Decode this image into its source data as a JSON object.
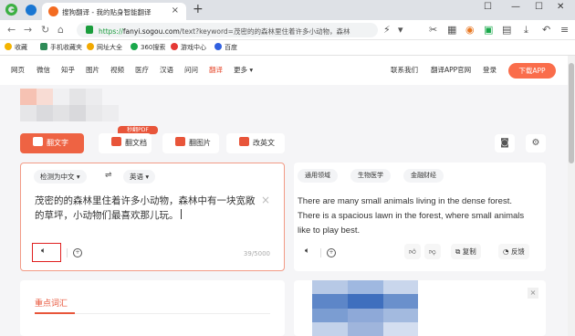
{
  "browser": {
    "tab_title": "搜狗翻译 - 我的贴身智能翻译",
    "tab_close": "×",
    "new_tab": "+",
    "window_controls": [
      "☐",
      "—",
      "☐",
      "✕"
    ],
    "url_scheme": "https://",
    "url_host": "fanyi.sogou.com",
    "url_rest": "/text?keyword=茂密的的森林里住着许多小动物，森林",
    "nav_icons": [
      "back-icon",
      "forward-icon",
      "refresh-icon",
      "home-icon"
    ]
  },
  "bookmarks": [
    {
      "label": "收藏",
      "color": "#f4b400"
    },
    {
      "label": "手机收藏夹",
      "color": "#2e8b57"
    },
    {
      "label": "网址大全",
      "color": "#f2a900"
    },
    {
      "label": "360搜索",
      "color": "#1aa84b"
    },
    {
      "label": "游戏中心",
      "color": "#e53935"
    },
    {
      "label": "百度",
      "color": "#3060e0"
    }
  ],
  "site_nav": {
    "items": [
      "网页",
      "微信",
      "知乎",
      "图片",
      "视频",
      "医疗",
      "汉语",
      "问问",
      "翻译",
      "更多"
    ],
    "active": "翻译",
    "right_links": [
      "联系我们",
      "翻译APP官网",
      "登录"
    ],
    "download_button": "下载APP"
  },
  "modes": {
    "pdf_badge": "秒翻PDF",
    "text": "翻文字",
    "doc": "翻文档",
    "img": "翻图片",
    "en": "改英文"
  },
  "source": {
    "detect_lang": "检测为中文",
    "swap": "⇌",
    "target_lang": "英语",
    "text": "茂密的的森林里住着许多小动物，森林中有一块宽敞的草坪，小动物们最喜欢那儿玩。",
    "clear": "×",
    "count": "39/5000"
  },
  "target": {
    "domains": [
      "通用领域",
      "生物医学",
      "金融财经"
    ],
    "text": "There are many small animals living in the dense forest. There is a spacious lawn in the forest, where small animals like to play best.",
    "copy": "复制",
    "feedback": "反馈"
  },
  "keywords": {
    "title": "重点词汇"
  },
  "ad": {
    "close": "×"
  }
}
